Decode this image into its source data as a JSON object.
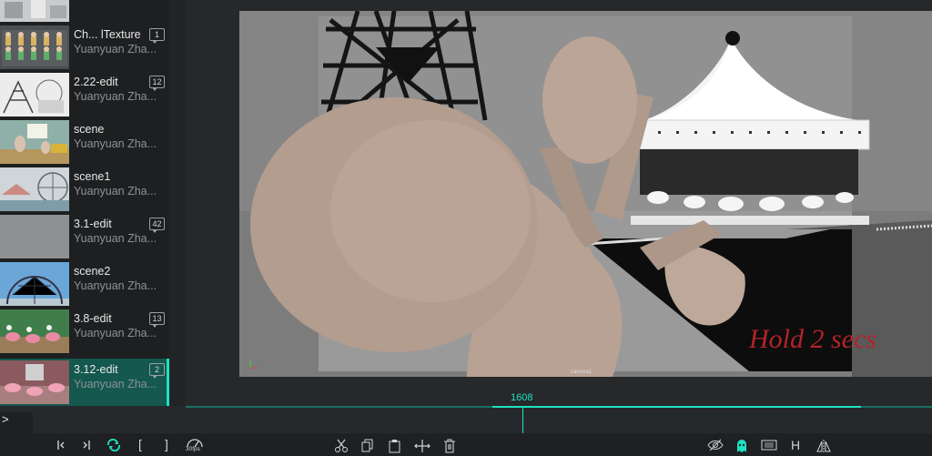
{
  "versions": [
    {
      "name": "",
      "author": "",
      "comments": ""
    },
    {
      "name": "Ch... lTexture",
      "author": "Yuanyuan Zha...",
      "comments": "1"
    },
    {
      "name": "2.22-edit",
      "author": "Yuanyuan Zha...",
      "comments": "12"
    },
    {
      "name": "scene",
      "author": "Yuanyuan Zha...",
      "comments": ""
    },
    {
      "name": "scene1",
      "author": "Yuanyuan Zha...",
      "comments": ""
    },
    {
      "name": "3.1-edit",
      "author": "Yuanyuan Zha...",
      "comments": "42"
    },
    {
      "name": "scene2",
      "author": "Yuanyuan Zha...",
      "comments": ""
    },
    {
      "name": "3.8-edit",
      "author": "Yuanyuan Zha...",
      "comments": "13"
    },
    {
      "name": "3.12-edit",
      "author": "Yuanyuan Zha...",
      "comments": "2",
      "selected": true
    }
  ],
  "viewer": {
    "camera_label": "camera1",
    "annotation": "Hold 2 secs"
  },
  "timeline": {
    "current_frame": "1608",
    "play_glyph": ">"
  },
  "toolbar": {
    "prev_frame": "|<",
    "next_frame": ">|",
    "loop": "loop-icon",
    "mark_in": "[",
    "mark_out": "]",
    "fps_label": "30fps",
    "hud_letter": "H"
  },
  "colors": {
    "accent": "#1de2c2",
    "selected_bg": "#14584f",
    "annotation_red": "#b42328"
  }
}
